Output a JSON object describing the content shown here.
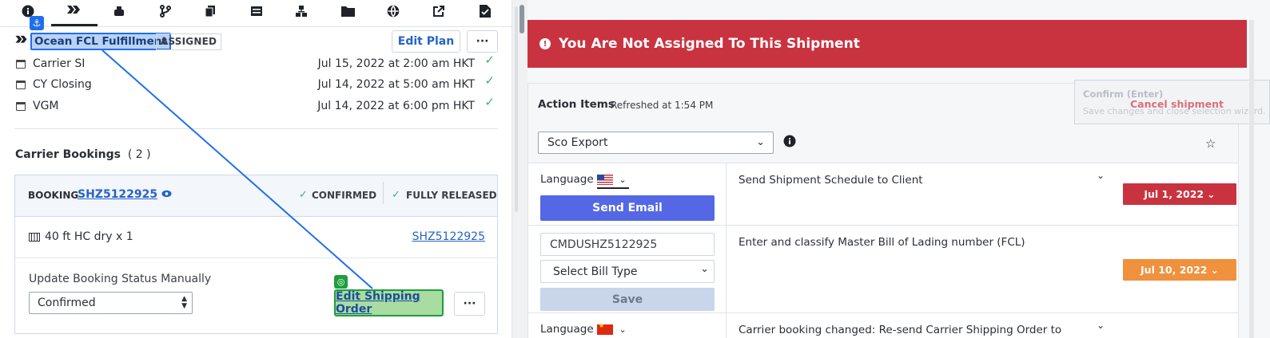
{
  "left_panel": {
    "tabs": [
      {
        "icon": "info-icon"
      },
      {
        "icon": "plan-icon",
        "active": true
      },
      {
        "icon": "cargo-icon"
      },
      {
        "icon": "branch-icon"
      },
      {
        "icon": "documents-icon"
      },
      {
        "icon": "container-icon"
      },
      {
        "icon": "hierarchy-icon"
      },
      {
        "icon": "folder-icon"
      },
      {
        "icon": "globe-icon"
      },
      {
        "icon": "external-link-icon"
      },
      {
        "icon": "file-check-icon"
      }
    ],
    "plan_title": "Ocean FCL Fulfillment",
    "plan_status": "ASSIGNED",
    "edit_plan_label": "Edit Plan",
    "more_label": "···",
    "milestones": [
      {
        "label": "Carrier SI",
        "date": "Jul 15, 2022 at 2:00 am HKT"
      },
      {
        "label": "CY Closing",
        "date": "Jul 14, 2022 at 5:00 am HKT"
      },
      {
        "label": "VGM",
        "date": "Jul 14, 2022 at 6:00 pm HKT"
      }
    ],
    "carrier_bookings_title": "Carrier Bookings",
    "carrier_bookings_count": "( 2 )",
    "booking": {
      "label": "BOOKING",
      "number": "SHZ5122925",
      "status_confirmed": "CONFIRMED",
      "status_released": "FULLY RELEASED",
      "container": "40 ft HC dry x 1",
      "container_link": "SHZ5122925",
      "update_label": "Update Booking Status Manually",
      "status_value": "Confirmed",
      "edit_so_label": "Edit Shipping Order",
      "more_label": "···"
    }
  },
  "right_panel": {
    "alert_text": "You Are Not Assigned To This Shipment",
    "action_items_title": "Action Items",
    "refreshed_text": "Refreshed at 1:54 PM",
    "workflow_select": "Sco Export",
    "tooltip_title": "Confirm (Enter)",
    "tooltip_sub": "Save changes and close selection wizard.",
    "cancel_shipment": "Cancel shipment",
    "rows": [
      {
        "language_label": "Language",
        "flag": "us-flag-icon",
        "button": "Send Email",
        "title": "Send Shipment Schedule to Client",
        "due": "Jul 1, 2022",
        "due_color": "#c9333f"
      },
      {
        "input_value": "CMDUSHZ5122925",
        "select_value": "Select Bill Type",
        "button": "Save",
        "title": "Enter and classify Master Bill of Lading number (FCL)",
        "due": "Jul 10, 2022",
        "due_color": "#f0913d"
      },
      {
        "language_label": "Language",
        "flag": "cn-flag-icon",
        "title": "Carrier booking changed: Re-send Carrier Shipping Order to"
      }
    ]
  }
}
